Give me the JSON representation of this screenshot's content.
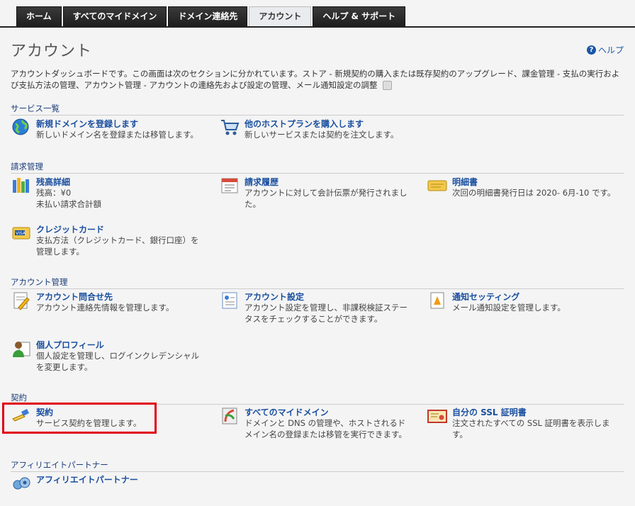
{
  "tabs": [
    {
      "label": "ホーム",
      "active": false
    },
    {
      "label": "すべてのマイドメイン",
      "active": false
    },
    {
      "label": "ドメイン連絡先",
      "active": false
    },
    {
      "label": "アカウント",
      "active": true
    },
    {
      "label": "ヘルプ & サポート",
      "active": false
    }
  ],
  "page": {
    "title": "アカウント",
    "help_label": "ヘルプ",
    "description": "アカウントダッシュボードです。この画面は次のセクションに分かれています。ストア - 新規契約の購入または既存契約のアップグレード、課金管理 - 支払の実行および支払方法の管理、アカウント管理 - アカウントの連絡先および設定の管理、メール通知設定の調整"
  },
  "sections": {
    "services": {
      "title": "サービス一覧",
      "items": [
        {
          "link": "新規ドメインを登録します",
          "text": "新しいドメイン名を登録または移管します。",
          "icon": "globe-icon"
        },
        {
          "link": "他のホストプランを購入します",
          "text": "新しいサービスまたは契約を注文します。",
          "icon": "cart-icon"
        }
      ]
    },
    "billing": {
      "title": "請求管理",
      "items": [
        {
          "link": "残高詳細",
          "text": "残高：¥0\n未払い請求合計額",
          "icon": "balance-icon"
        },
        {
          "link": "請求履歴",
          "text": "アカウントに対して会計伝票が発行されました。",
          "icon": "invoice-icon"
        },
        {
          "link": "明細書",
          "text": "次回の明細書発行日は 2020- 6月-10 です。",
          "icon": "statement-icon"
        },
        {
          "link": "クレジットカード",
          "text": "支払方法（クレジットカード、銀行口座）を管理します。",
          "icon": "credit-card-icon"
        }
      ]
    },
    "account": {
      "title": "アカウント管理",
      "items": [
        {
          "link": "アカウント問合せ先",
          "text": "アカウント連絡先情報を管理します。",
          "icon": "contact-icon"
        },
        {
          "link": "アカウント設定",
          "text": "アカウント設定を管理し、非課税検証ステータスをチェックすることができます。",
          "icon": "settings-doc-icon"
        },
        {
          "link": "通知セッティング",
          "text": "メール通知設定を管理します。",
          "icon": "notify-icon"
        },
        {
          "link": "個人プロフィール",
          "text": "個人設定を管理し、ログインクレデンシャルを変更します。",
          "icon": "profile-icon"
        }
      ]
    },
    "contracts": {
      "title": "契約",
      "items": [
        {
          "link": "契約",
          "text": "サービス契約を管理します。",
          "icon": "contract-icon"
        },
        {
          "link": "すべてのマイドメイン",
          "text": "ドメインと DNS の管理や、ホストされるドメイン名の登録または移管を実行できます。",
          "icon": "domains-icon"
        },
        {
          "link": "自分の SSL 証明書",
          "text": "注文されたすべての SSL 証明書を表示します。",
          "icon": "ssl-certificate-icon"
        }
      ]
    },
    "affiliate": {
      "title": "アフィリエイトパートナー",
      "items": [
        {
          "link": "アフィリエイトパートナー",
          "text": "",
          "icon": "affiliate-icon"
        }
      ]
    }
  }
}
